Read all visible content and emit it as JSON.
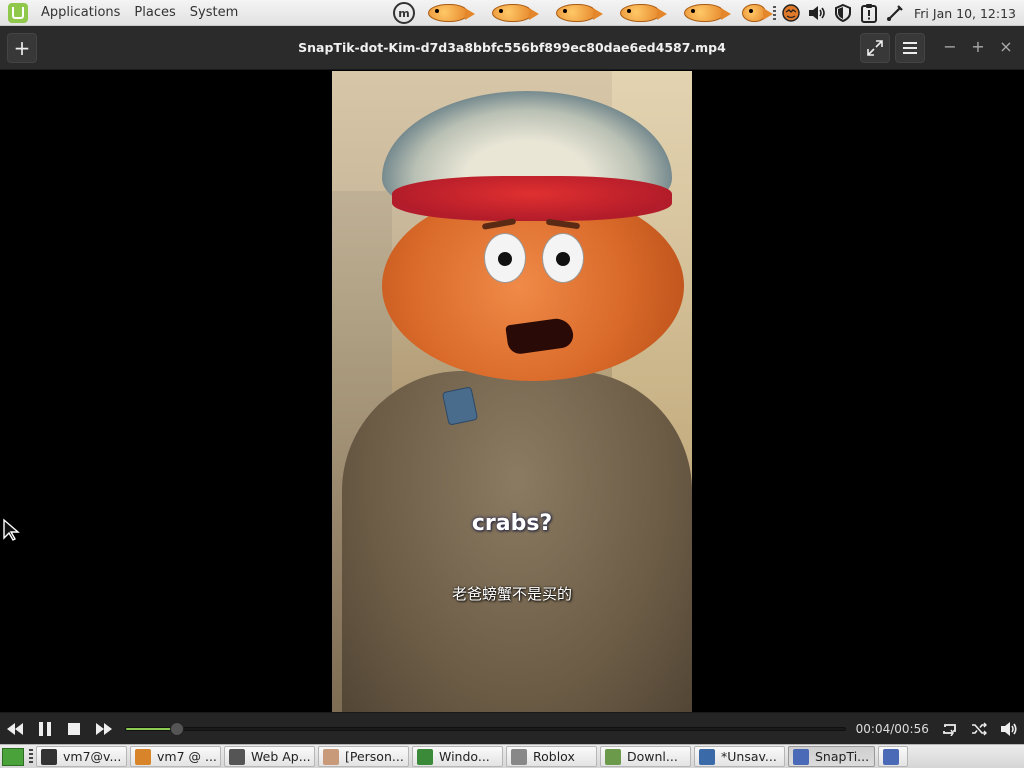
{
  "top_panel": {
    "menus": [
      "Applications",
      "Places",
      "System"
    ],
    "clock": "Fri Jan 10, 12:13",
    "fish_count": 6,
    "tray_icons": [
      "mint-update-icon",
      "fish-applet-icon",
      "volume-icon",
      "shield-icon",
      "clipboard-alert-icon",
      "network-icon"
    ]
  },
  "window": {
    "title": "SnapTik-dot-Kim-d7d3a8bbfc556bf899ec80dae6ed4587.mp4",
    "add_label": "+",
    "fullscreen_label": "⤢",
    "menu_label": "☰",
    "minimize_label": "−",
    "maximize_label": "+",
    "close_label": "×"
  },
  "video": {
    "subtitle_en": "crabs?",
    "subtitle_zh": "老爸螃蟹不是买的"
  },
  "player": {
    "time": "00:04/00:56",
    "progress": 0.071,
    "rewind_label": "⏪",
    "pause_label": "❚❚",
    "stop_label": "■",
    "forward_label": "⏩",
    "repeat_label": "⟲",
    "shuffle_label": "⤮",
    "volume_label": "🔊"
  },
  "taskbar": {
    "tasks": [
      {
        "label": "vm7@v...",
        "icon": "terminal-icon",
        "color": "#333333"
      },
      {
        "label": "vm7 @ ...",
        "icon": "fish-app-icon",
        "color": "#d8842a"
      },
      {
        "label": "Web Ap...",
        "icon": "web-app-icon",
        "color": "#555555"
      },
      {
        "label": "[Person...",
        "icon": "person-icon",
        "color": "#c89a7a"
      },
      {
        "label": "Windo...",
        "icon": "windows-icon",
        "color": "#3a8a3a"
      },
      {
        "label": "Roblox",
        "icon": "roblox-icon",
        "color": "#888888"
      },
      {
        "label": "Downl...",
        "icon": "folder-icon",
        "color": "#6a9a4a"
      },
      {
        "label": "*Unsav...",
        "icon": "text-editor-icon",
        "color": "#3a6aa8"
      },
      {
        "label": "SnapTi...",
        "icon": "video-player-icon",
        "color": "#4a6ab8"
      }
    ]
  }
}
